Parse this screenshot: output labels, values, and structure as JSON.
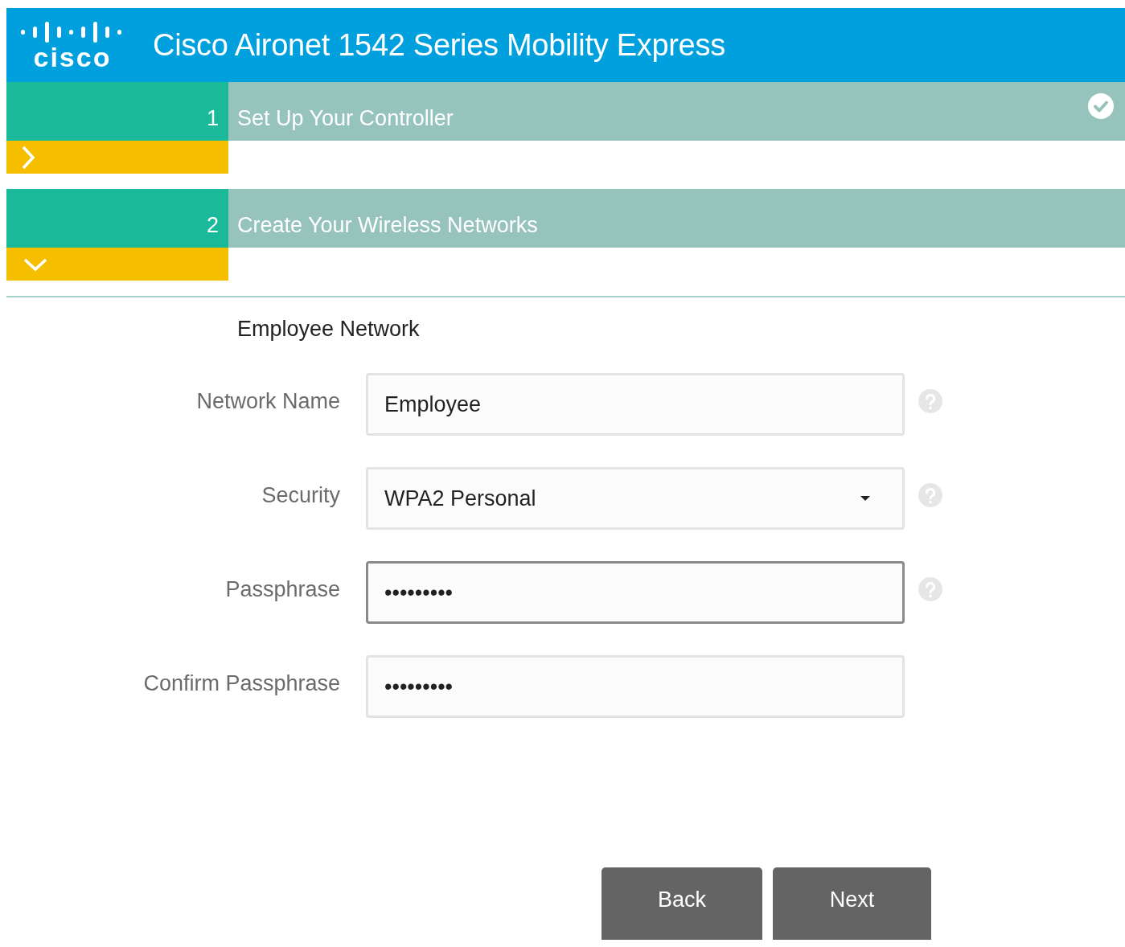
{
  "header": {
    "logo_text": "cisco",
    "title": "Cisco Aironet 1542 Series Mobility Express"
  },
  "steps": [
    {
      "number": "1",
      "title": "Set Up Your Controller",
      "completed": true,
      "expanded": false
    },
    {
      "number": "2",
      "title": "Create Your Wireless Networks",
      "completed": false,
      "expanded": true
    }
  ],
  "section": {
    "title": "Employee Network"
  },
  "fields": [
    {
      "label": "Network Name",
      "kind": "text",
      "value": "Employee",
      "focused": false,
      "help": true
    },
    {
      "label": "Security",
      "kind": "select",
      "value": "WPA2 Personal",
      "focused": false,
      "help": true
    },
    {
      "label": "Passphrase",
      "kind": "text",
      "value": "•••••••••",
      "focused": true,
      "help": true
    },
    {
      "label": "Confirm Passphrase",
      "kind": "text",
      "value": "•••••••••",
      "focused": false,
      "help": false
    }
  ],
  "buttons": [
    "Back",
    "Next"
  ]
}
